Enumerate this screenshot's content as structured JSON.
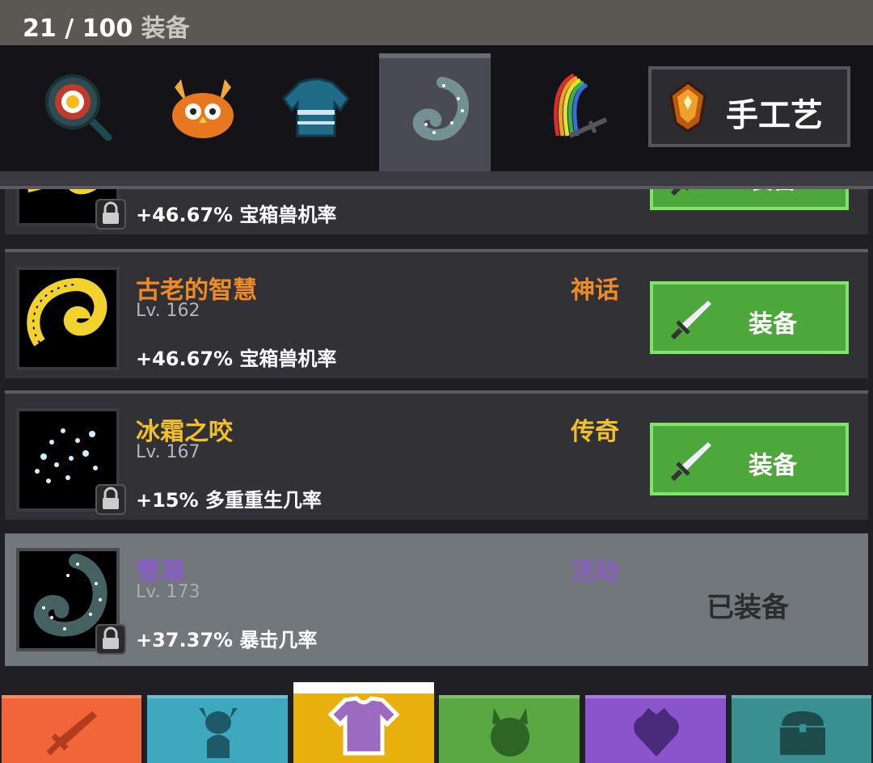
{
  "header": {
    "count": "21 / 100",
    "label": "装备"
  },
  "category_tabs": [
    {
      "name": "frying-pan-icon",
      "active": false
    },
    {
      "name": "owl-hat-icon",
      "active": false
    },
    {
      "name": "sweater-icon",
      "active": false
    },
    {
      "name": "frost-swirl-icon",
      "active": true
    },
    {
      "name": "rainbow-sword-icon",
      "active": false
    }
  ],
  "craft_button": {
    "label": "手工艺",
    "icon": "crafting-gem-icon"
  },
  "items": [
    {
      "name": "",
      "level": "",
      "stat": "+46.67% 宝箱兽机率",
      "rarity": "",
      "action": "装备",
      "locked": true,
      "equipped": false
    },
    {
      "name": "古老的智慧",
      "name_color": "#f08a24",
      "level": "Lv. 162",
      "stat": "+46.67% 宝箱兽机率",
      "rarity": "神话",
      "rarity_color": "#f08a24",
      "action": "装备",
      "locked": false,
      "equipped": false
    },
    {
      "name": "冰霜之咬",
      "name_color": "#f2c02a",
      "level": "Lv. 167",
      "stat": "+15% 多重重生几率",
      "rarity": "传奇",
      "rarity_color": "#f2c02a",
      "action": "装备",
      "locked": true,
      "equipped": false
    },
    {
      "name": "雪凝",
      "name_color": "#8a5cc7",
      "level": "Lv. 173",
      "stat": "+37.37% 暴击几率",
      "rarity": "活动",
      "rarity_color": "#8a5cc7",
      "action": "已装备",
      "locked": true,
      "equipped": true
    }
  ],
  "bottom_nav": [
    {
      "name": "sword-icon",
      "color": "#f0663a",
      "active": false
    },
    {
      "name": "viking-icon",
      "color": "#3ea8bf",
      "active": false
    },
    {
      "name": "shirt-icon",
      "color": "#e8b00c",
      "active": true
    },
    {
      "name": "pet-icon",
      "color": "#5aa844",
      "active": false
    },
    {
      "name": "crest-icon",
      "color": "#8a55cc",
      "active": false
    },
    {
      "name": "chest-icon",
      "color": "#3a9090",
      "active": false
    }
  ]
}
